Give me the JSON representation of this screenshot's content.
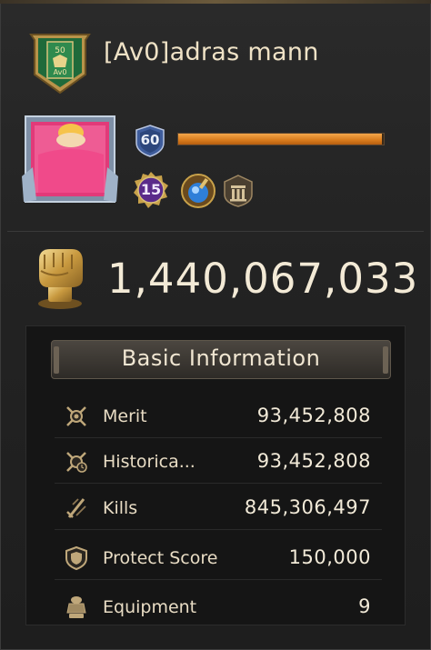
{
  "player": {
    "name": "[Av0]adras mann",
    "banner_text_top": "50",
    "banner_text_bottom": "Av0",
    "level": "60",
    "xp_progress": 0.99,
    "rank": "15",
    "power": "1,440,067,033"
  },
  "basic_info": {
    "title": "Basic Information",
    "rows": [
      {
        "icon": "swords-crest-icon",
        "label": "Merit",
        "value": "93,452,808"
      },
      {
        "icon": "swords-history-icon",
        "label": "Historica...",
        "value": "93,452,808"
      },
      {
        "icon": "blade-icon",
        "label": "Kills",
        "value": "845,306,497"
      },
      {
        "icon": "shield-icon",
        "label": "Protect Score",
        "value": "150,000"
      },
      {
        "icon": "armor-icon",
        "label": "Equipment",
        "value": "9"
      }
    ]
  },
  "colors": {
    "xp_bar": "#e08a25",
    "gold": "#c9a24a",
    "panel": "#232323"
  }
}
